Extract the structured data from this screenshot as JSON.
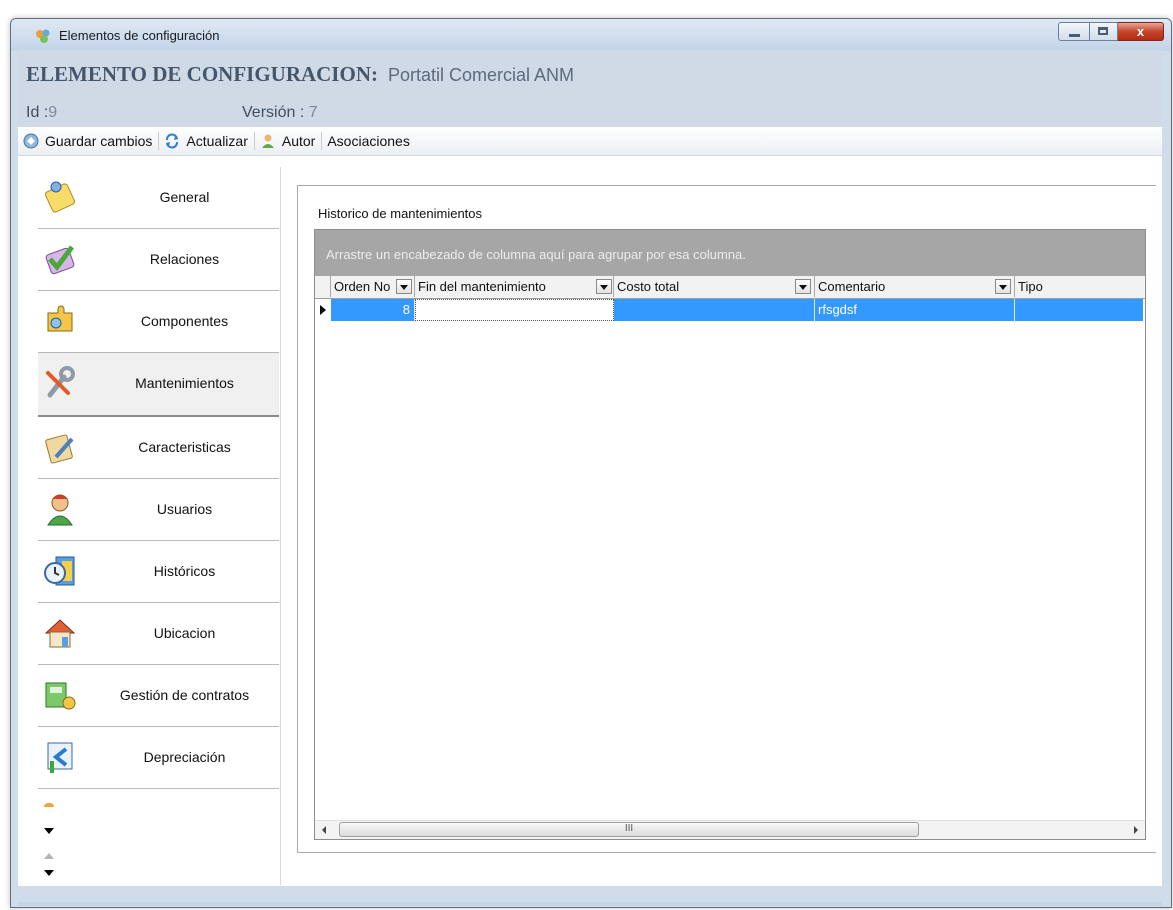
{
  "window": {
    "title": "Elementos de configuración",
    "close_glyph": "x"
  },
  "header": {
    "label": "ELEMENTO DE CONFIGURACION:",
    "name": "Portatil Comercial ANM",
    "id_label": "Id :",
    "id_value": "9",
    "version_label": "Versión :",
    "version_value": "7"
  },
  "toolbar": {
    "save_label": "Guardar cambios",
    "refresh_label": "Actualizar",
    "author_label": "Autor",
    "associations_label": "Asociaciones"
  },
  "sidebar": {
    "items": [
      {
        "label": "General",
        "icon": "notepad-icon"
      },
      {
        "label": "Relaciones",
        "icon": "checkmark-icon"
      },
      {
        "label": "Componentes",
        "icon": "puzzle-icon"
      },
      {
        "label": "Mantenimientos",
        "icon": "wrench-icon"
      },
      {
        "label": "Caracteristicas",
        "icon": "clipboard-edit-icon"
      },
      {
        "label": "Usuarios",
        "icon": "user-icon"
      },
      {
        "label": "Históricos",
        "icon": "clock-calendar-icon"
      },
      {
        "label": "Ubicacion",
        "icon": "house-icon"
      },
      {
        "label": "Gestión de contratos",
        "icon": "money-icon"
      },
      {
        "label": "Depreciación",
        "icon": "depreciation-icon"
      }
    ],
    "active_index": 3
  },
  "panel": {
    "title": "Historico de mantenimientos",
    "group_hint": "Arrastre un encabezado de columna aquí para agrupar por esa columna.",
    "columns": [
      "Orden No",
      "Fin del mantenimiento",
      "Costo total",
      "Comentario",
      "Tipo"
    ],
    "rows": [
      {
        "orden": "8",
        "fin": "",
        "costo": "",
        "comentario": "rfsgdsf",
        "tipo": ""
      }
    ],
    "scroll_grip": "III"
  },
  "colors": {
    "selection": "#3399ff",
    "group_bar": "#a6a6a6",
    "header_bg": "#cfdae6"
  }
}
